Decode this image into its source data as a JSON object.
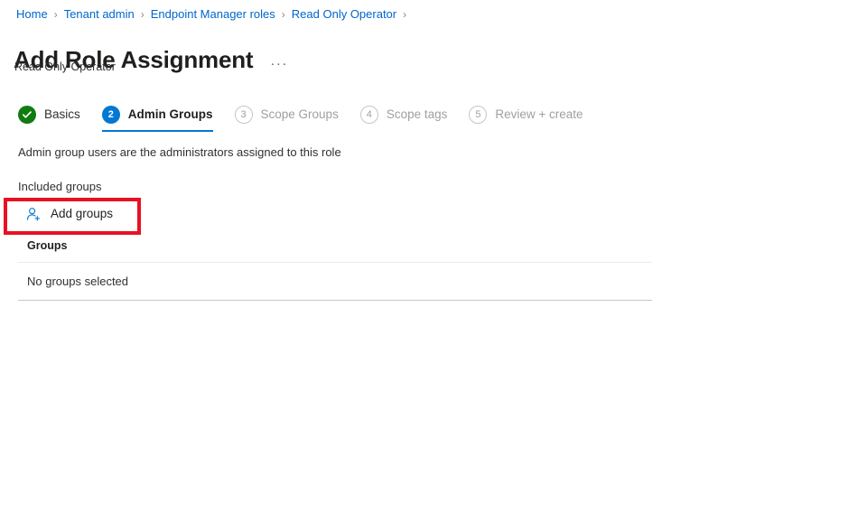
{
  "breadcrumb": {
    "separator": "›",
    "items": [
      {
        "label": "Home"
      },
      {
        "label": "Tenant admin"
      },
      {
        "label": "Endpoint Manager roles"
      },
      {
        "label": "Read Only Operator"
      }
    ]
  },
  "header": {
    "title": "Add Role Assignment",
    "more_label": "···",
    "subtitle": "Read Only Operator"
  },
  "wizard": {
    "steps": [
      {
        "number": "✓",
        "label": "Basics",
        "state": "done"
      },
      {
        "number": "2",
        "label": "Admin Groups",
        "state": "current"
      },
      {
        "number": "3",
        "label": "Scope Groups",
        "state": "disabled"
      },
      {
        "number": "4",
        "label": "Scope tags",
        "state": "disabled"
      },
      {
        "number": "5",
        "label": "Review + create",
        "state": "disabled"
      }
    ]
  },
  "main": {
    "description": "Admin group users are the administrators assigned to this role",
    "included_groups_label": "Included groups",
    "add_groups_button": {
      "label": "Add groups",
      "icon": "person-add-icon"
    },
    "groups_table": {
      "columns": [
        "Groups"
      ],
      "rows": [
        [
          "No groups selected"
        ]
      ]
    }
  },
  "annotation": {
    "highlight_color": "#e81123",
    "target": "add-groups-button"
  },
  "colors": {
    "link": "#0066cc",
    "accent": "#0078d4",
    "success": "#107c10",
    "disabled_text": "#a19f9d",
    "text": "#323130"
  }
}
